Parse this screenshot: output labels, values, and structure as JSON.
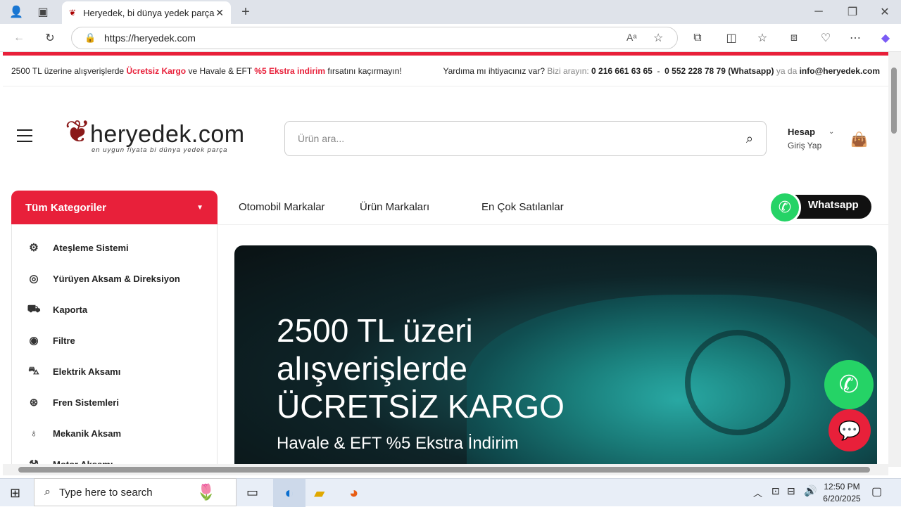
{
  "browser": {
    "tab_title": "Heryedek, bi dünya yedek parça",
    "url": "https://heryedek.com"
  },
  "topbar": {
    "left_1": "2500 TL üzerine alışverişlerde ",
    "left_red_1": "Ücretsiz Kargo",
    "left_2": " ve Havale & EFT ",
    "left_red_2": "%5 Ekstra indirim",
    "left_3": " fırsatını kaçırmayın!",
    "help_q": "Yardıma mı ihtiyacınız var? ",
    "call": "Bizi arayın: ",
    "phone1": "0 216 661 63 65",
    "sep": "  -  ",
    "phone2": "0 552 228 78 79 (Whatsapp)",
    "or": " ya da ",
    "email": "info@heryedek.com"
  },
  "logo": {
    "name": "heryedek.com",
    "tagline": "en uygun fiyata bi dünya yedek parça"
  },
  "search": {
    "placeholder": "Ürün ara..."
  },
  "account": {
    "label": "Hesap",
    "sub": "Giriş Yap"
  },
  "categories": {
    "button": "Tüm Kategoriler",
    "items": [
      "Ateşleme Sistemi",
      "Yürüyen Aksam & Direksiyon",
      "Kaporta",
      "Filtre",
      "Elektrik Aksamı",
      "Fren Sistemleri",
      "Mekanik Aksam",
      "Motor Aksamı"
    ]
  },
  "nav": [
    "Otomobil Markalar",
    "Ürün Markaları",
    "En Çok Satılanlar"
  ],
  "whatsapp_badge": "Whatsapp",
  "hero": {
    "title": "2500 TL üzeri alışverişlerde ÜCRETSİZ KARGO",
    "subtitle": "Havale & EFT %5 Ekstra İndirim"
  },
  "taskbar": {
    "search_placeholder": "Type here to search",
    "time": "12:50 PM",
    "date": "6/20/2025"
  },
  "colors": {
    "accent": "#e8203a",
    "whatsapp": "#25d366"
  }
}
